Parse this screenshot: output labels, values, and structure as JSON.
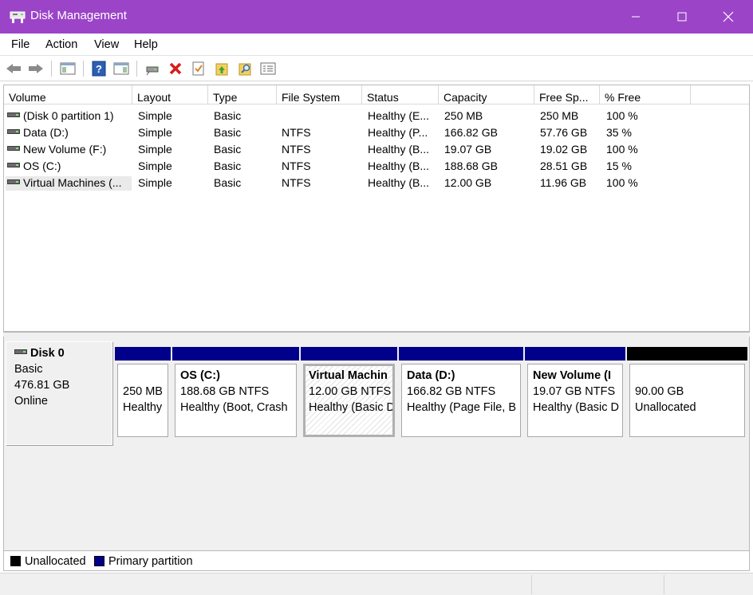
{
  "window": {
    "title": "Disk Management",
    "accent": "#9b44c8"
  },
  "menu": [
    "File",
    "Action",
    "View",
    "Help"
  ],
  "toolbar": {
    "icons": [
      "back-icon",
      "forward-icon",
      "show-hide-console-tree-icon",
      "help-icon",
      "show-hide-action-pane-icon",
      "connect-drive-icon",
      "delete-icon",
      "checklist-icon",
      "folder-up-icon",
      "find-icon",
      "properties-icon"
    ]
  },
  "volume_list": {
    "columns": [
      "Volume",
      "Layout",
      "Type",
      "File System",
      "Status",
      "Capacity",
      "Free Sp...",
      "% Free"
    ],
    "rows": [
      [
        "(Disk 0 partition 1)",
        "Simple",
        "Basic",
        "",
        "Healthy (E...",
        "250 MB",
        "250 MB",
        "100 %"
      ],
      [
        "Data (D:)",
        "Simple",
        "Basic",
        "NTFS",
        "Healthy (P...",
        "166.82 GB",
        "57.76 GB",
        "35 %"
      ],
      [
        "New Volume (F:)",
        "Simple",
        "Basic",
        "NTFS",
        "Healthy (B...",
        "19.07 GB",
        "19.02 GB",
        "100 %"
      ],
      [
        "OS (C:)",
        "Simple",
        "Basic",
        "NTFS",
        "Healthy (B...",
        "188.68 GB",
        "28.51 GB",
        "15 %"
      ],
      [
        "Virtual Machines (...",
        "Simple",
        "Basic",
        "NTFS",
        "Healthy (B...",
        "12.00 GB",
        "11.96 GB",
        "100 %"
      ]
    ]
  },
  "disk": {
    "name": "Disk 0",
    "type": "Basic",
    "size": "476.81 GB",
    "status": "Online"
  },
  "partitions": [
    {
      "name": "",
      "size_fs": "250 MB",
      "status": "Healthy",
      "kind": "primary"
    },
    {
      "name": "OS  (C:)",
      "size_fs": "188.68 GB NTFS",
      "status": "Healthy (Boot, Crash",
      "kind": "primary"
    },
    {
      "name": "Virtual Machin",
      "size_fs": "12.00 GB NTFS",
      "status": "Healthy (Basic D",
      "kind": "primary"
    },
    {
      "name": "Data  (D:)",
      "size_fs": "166.82 GB NTFS",
      "status": "Healthy (Page File, B",
      "kind": "primary"
    },
    {
      "name": "New Volume  (I",
      "size_fs": "19.07 GB NTFS",
      "status": "Healthy (Basic D",
      "kind": "primary"
    },
    {
      "name": "",
      "size_fs": "90.00 GB",
      "status": "Unallocated",
      "kind": "unallocated"
    }
  ],
  "legend": [
    {
      "label": "Unallocated",
      "color": "#000000"
    },
    {
      "label": "Primary partition",
      "color": "#00008b"
    }
  ]
}
